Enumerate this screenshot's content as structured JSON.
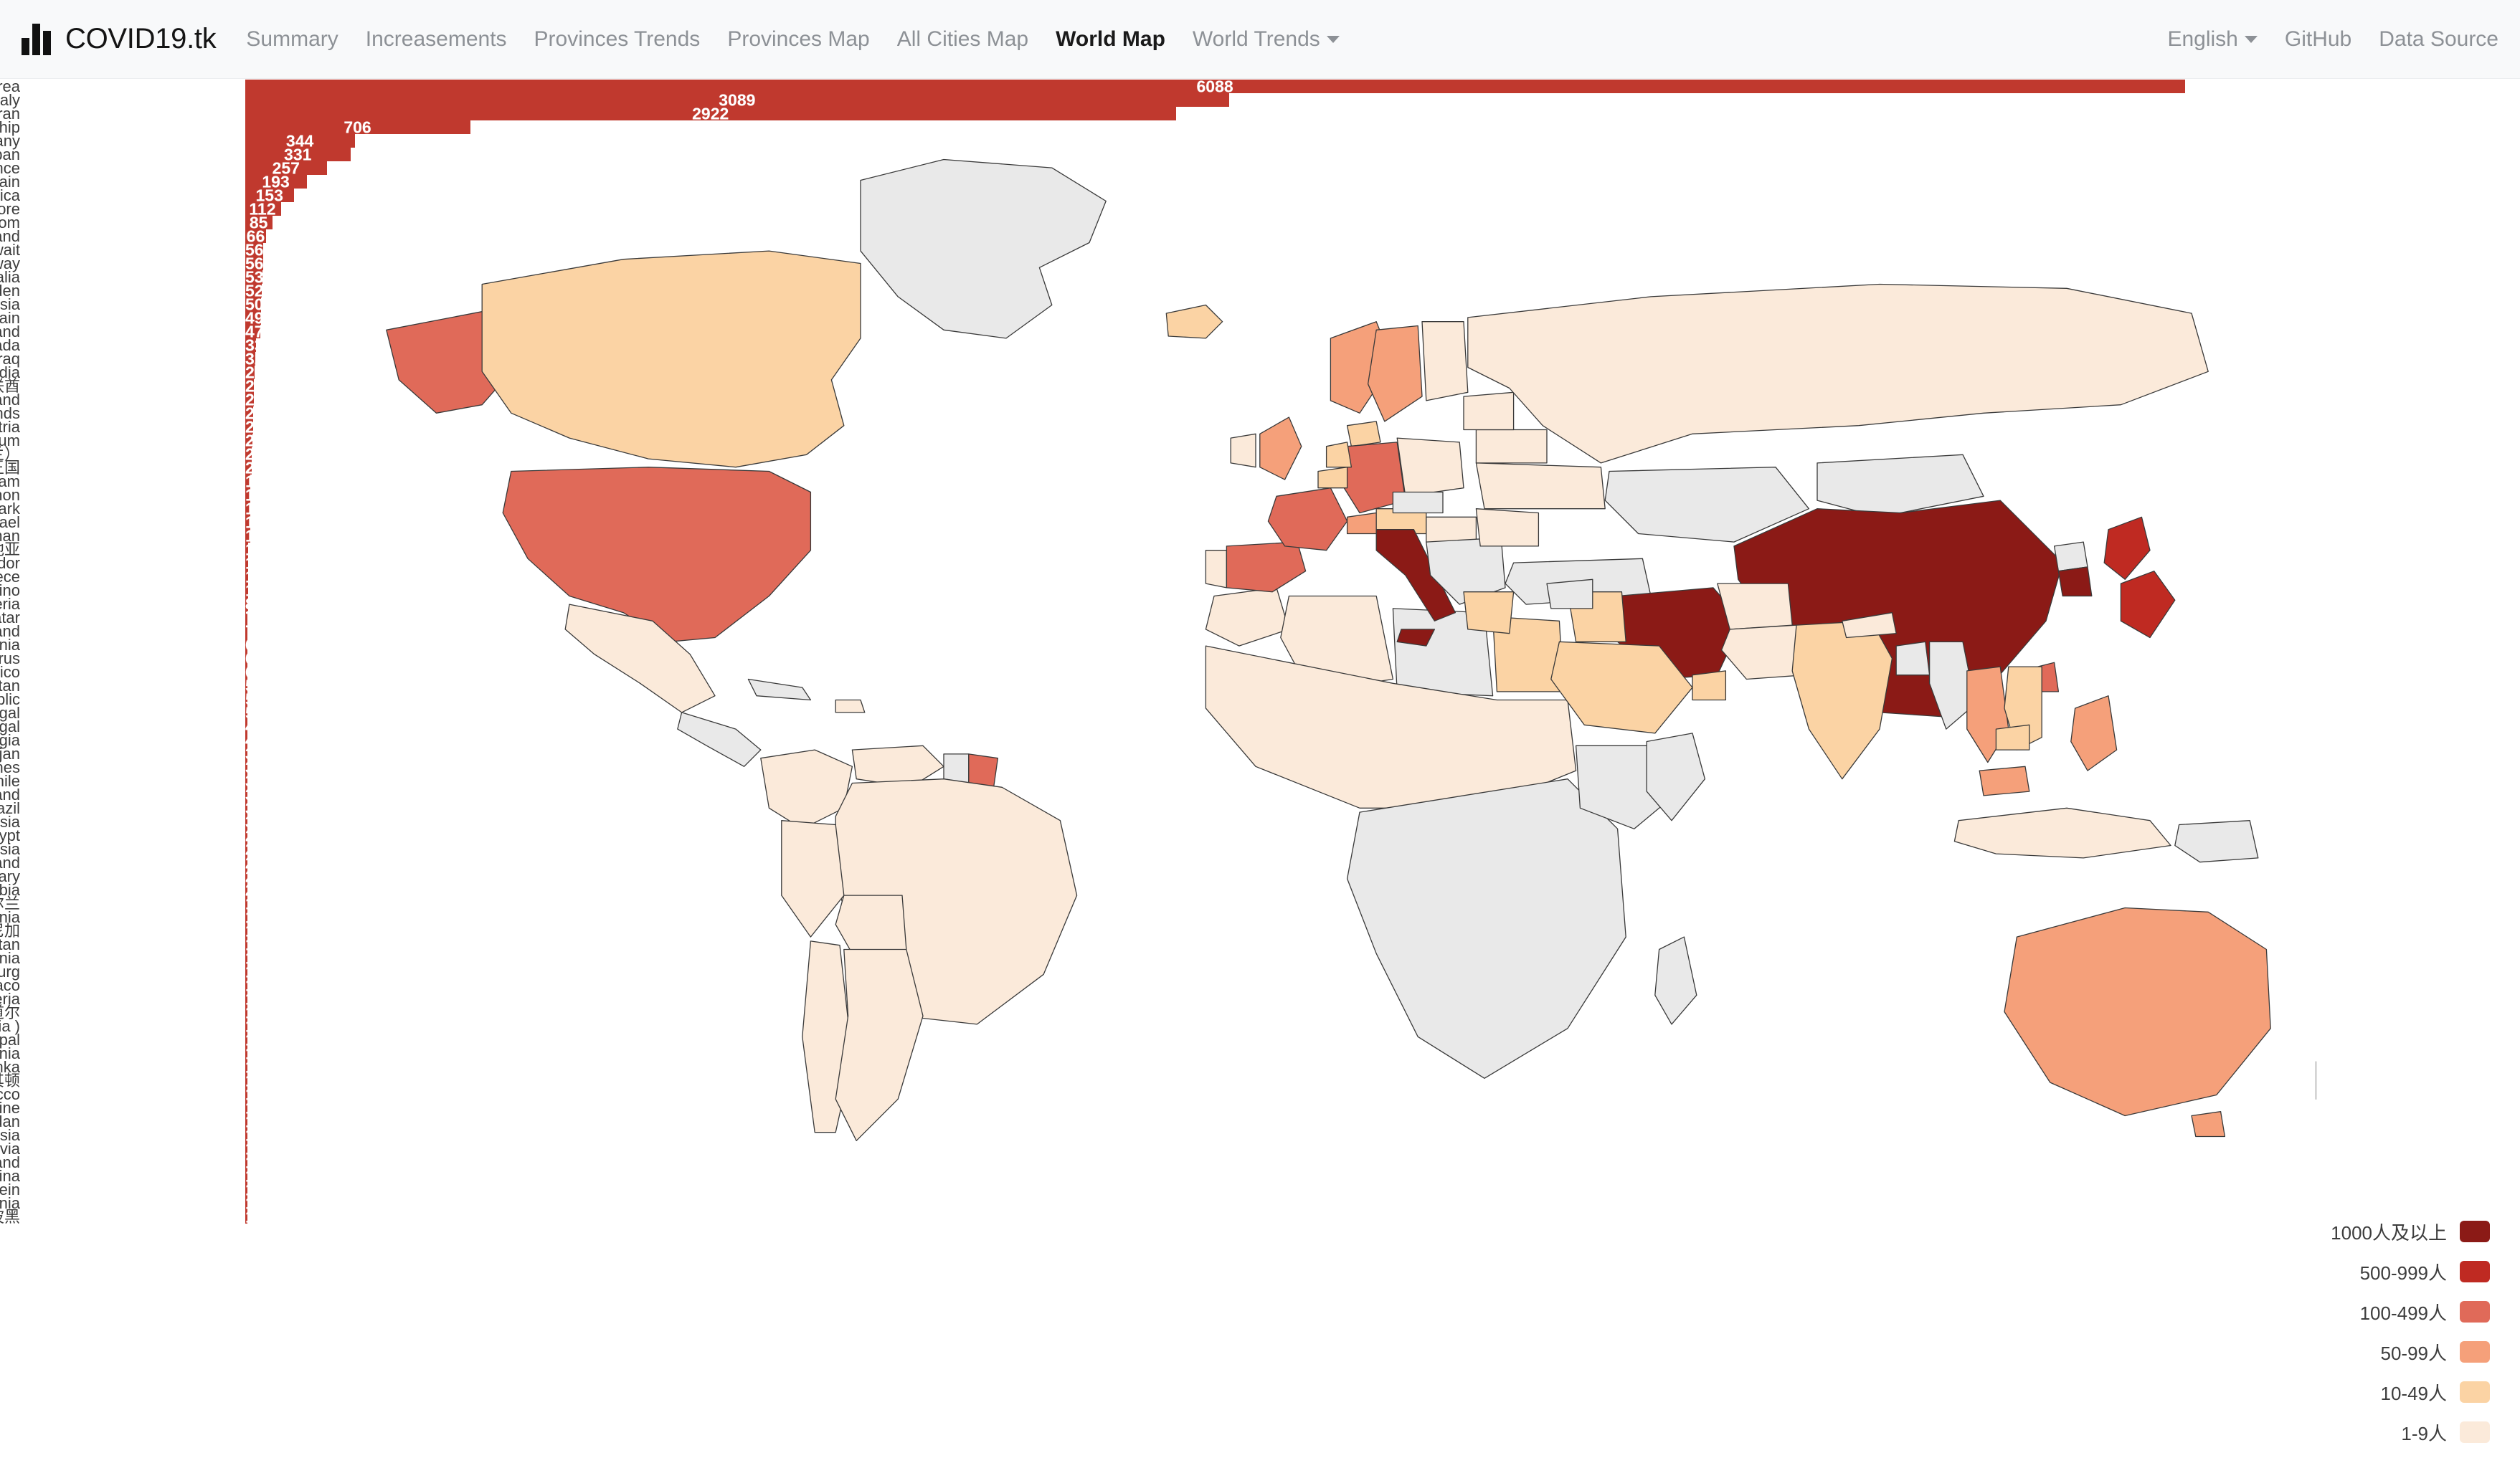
{
  "navbar": {
    "brand": "COVID19.tk",
    "brand_logo_icon": "bar-chart-icon",
    "left_links": [
      {
        "label": "Summary",
        "active": false,
        "caret": false
      },
      {
        "label": "Increasements",
        "active": false,
        "caret": false
      },
      {
        "label": "Provinces Trends",
        "active": false,
        "caret": false
      },
      {
        "label": "Provinces Map",
        "active": false,
        "caret": false
      },
      {
        "label": "All Cities Map",
        "active": false,
        "caret": false
      },
      {
        "label": "World Map",
        "active": true,
        "caret": false
      },
      {
        "label": "World Trends",
        "active": false,
        "caret": true
      }
    ],
    "right_links": [
      {
        "label": "English",
        "caret": true
      },
      {
        "label": "GitHub",
        "caret": false
      },
      {
        "label": "Data Source",
        "caret": false
      }
    ]
  },
  "legend": {
    "title": "",
    "items": [
      {
        "label": "1000人及以上",
        "color": "#8b1a16"
      },
      {
        "label": "500-999人",
        "color": "#bf2a22"
      },
      {
        "label": "100-499人",
        "color": "#e06a59"
      },
      {
        "label": "50-99人",
        "color": "#f5a07a"
      },
      {
        "label": "10-49人",
        "color": "#fbd3a4"
      },
      {
        "label": "1-9人",
        "color": "#fbeada"
      }
    ]
  },
  "map": {
    "no_data_color": "#e9e9e9",
    "ocean_color": "#ffffff",
    "border_color": "#3a3a3a"
  },
  "chart_data": {
    "type": "bar",
    "orientation": "horizontal",
    "title": "",
    "xlabel": "",
    "ylabel": "",
    "bar_color": "#c0392e",
    "value_label_color": "#ffffff",
    "xlim": [
      0,
      6088
    ],
    "grid": false,
    "legend": "none",
    "categories": [
      "Korea",
      "Italy",
      "Iran",
      "mond Princess Cruise Ship",
      "Germany",
      "Japan",
      "France",
      "Spain",
      "United States of America",
      "Singapore",
      "United Kiongdom",
      "Switzerland",
      "Kuwait",
      "Norway",
      "Australia",
      "Sweden",
      "Malaysia",
      "Bahrain",
      "Thailand",
      "Canada",
      "Iraq",
      "India",
      "阿联酋",
      "Iceland",
      "Netherlands",
      "Austria",
      "Belgium",
      "英国（含北爱尔兰）",
      "不列颠及北爱尔兰联合王国",
      "Vietnam",
      "Lebanon",
      "Denmark",
      "Israel",
      "Oman",
      "克罗地亚",
      "Ecuador",
      "Greece",
      "San Marino",
      "Algeria",
      "Qatar",
      "Finland",
      "Romania",
      "Belarus",
      "Mexico",
      "Pakistan",
      "Czech Republic",
      "Portugal",
      "Senegal",
      "Georgia",
      "Azerbaijan",
      "Philippines",
      "Chile",
      "New Zealand",
      "Brazil",
      "Russia",
      "Egypt",
      "Indonesia",
      "Ireland",
      "Hungary",
      "Saudi Arabia",
      "北爱尔兰",
      "Estonia",
      "多米尼加",
      "Afghanistan",
      "Lithuania",
      "Luxembourg",
      "Monaco",
      "Nigeria",
      "安道尔",
      "Kampuchea (Cambodia )",
      "Nepal",
      "Armenia",
      "SriLanka",
      "北马其顿",
      "Morocco",
      "Ukraine",
      "Jordan",
      "Tunisia",
      "Latvia",
      "Poland",
      "Argentina",
      "Liechtenstein",
      "Slovenia",
      "波黑"
    ],
    "values": [
      6088,
      3089,
      2922,
      706,
      344,
      331,
      257,
      193,
      153,
      112,
      85,
      66,
      56,
      56,
      53,
      52,
      50,
      49,
      47,
      33,
      32,
      29,
      28,
      26,
      24,
      24,
      23,
      20,
      20,
      16,
      15,
      15,
      15,
      15,
      10,
      10,
      10,
      10,
      8,
      7,
      7,
      6,
      6,
      6,
      5,
      5,
      5,
      4,
      4,
      3,
      3,
      3,
      3,
      3,
      3,
      2,
      2,
      2,
      2,
      2,
      1,
      1,
      1,
      1,
      1,
      1,
      1,
      1,
      1,
      1,
      1,
      1,
      1,
      1,
      1,
      1,
      1,
      1,
      1,
      1,
      1,
      1,
      1,
      1
    ]
  }
}
